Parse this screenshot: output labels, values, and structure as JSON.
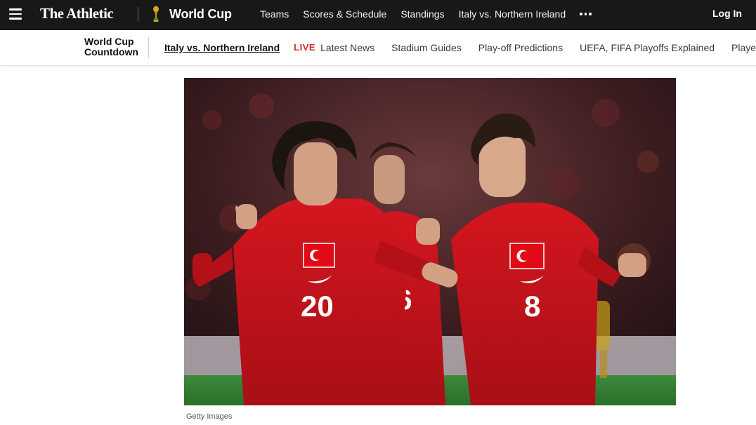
{
  "header": {
    "brand": "The Athletic",
    "section": "World Cup",
    "nav": [
      "Teams",
      "Scores & Schedule",
      "Standings",
      "Italy vs. Northern Ireland"
    ],
    "login_label": "Log In"
  },
  "subnav": {
    "countdown_line1": "World Cup",
    "countdown_line2": "Countdown",
    "active_item": "Italy vs. Northern Ireland",
    "live_badge": "LIVE",
    "items": [
      "Latest News",
      "Stadium Guides",
      "Play-off Predictions",
      "UEFA, FIFA Playoffs Explained",
      "Players to Watch"
    ]
  },
  "hero": {
    "caption": "Getty Images",
    "jersey_numbers": [
      "20",
      "16",
      "8"
    ]
  },
  "colors": {
    "topbar_bg": "#181818",
    "live_red": "#d42b2b",
    "jersey_red": "#c8141c",
    "trophy_gold": "#d9a520"
  },
  "icons": [
    "menu-icon",
    "trophy-icon",
    "more-icon"
  ]
}
